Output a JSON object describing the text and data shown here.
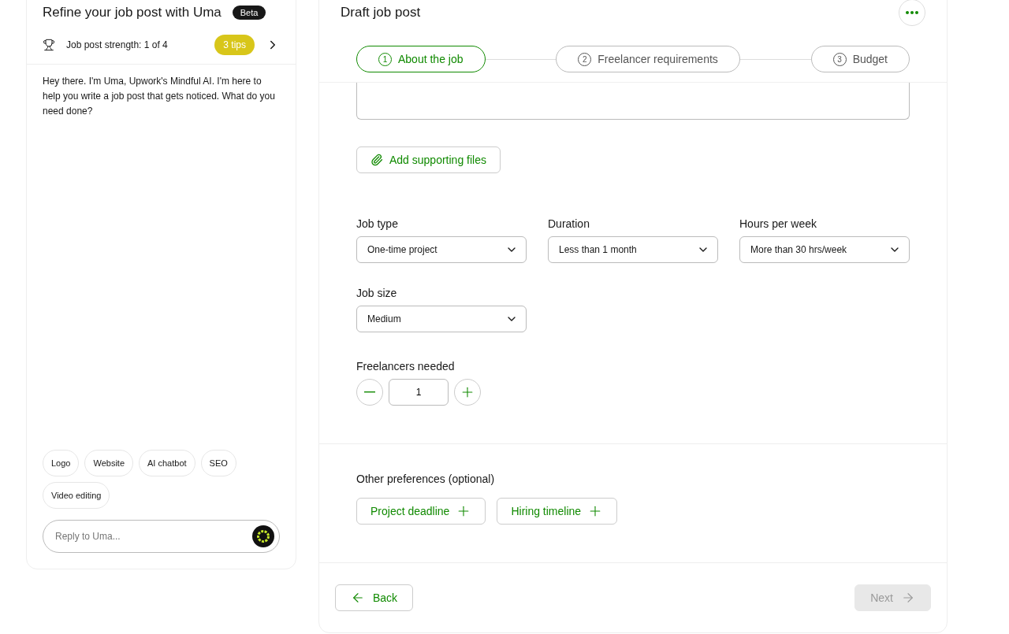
{
  "assistant": {
    "title": "Refine your job post with Uma",
    "badge": "Beta",
    "strength": {
      "label": "Job post strength: 1 of 4",
      "tips": "3 tips"
    },
    "message": "Hey there. I'm Uma, Upwork's Mindful AI. I'm here to help you write a job post that gets noticed. What do you need done?",
    "suggestions": [
      "Logo",
      "Website",
      "AI chatbot",
      "SEO",
      "Video editing"
    ],
    "reply": {
      "placeholder": "Reply to Uma..."
    }
  },
  "editor": {
    "title": "Draft job post",
    "steps": [
      {
        "number": "1",
        "label": "About the job",
        "selected": true
      },
      {
        "number": "2",
        "label": "Freelancer requirements",
        "selected": false
      },
      {
        "number": "3",
        "label": "Budget",
        "selected": false
      }
    ],
    "attach_button": "Add supporting files",
    "selects": [
      {
        "label": "Job type",
        "value": "One-time project"
      },
      {
        "label": "Duration",
        "value": "Less than 1 month"
      },
      {
        "label": "Hours per week",
        "value": "More than 30 hrs/week"
      },
      {
        "label": "Job size",
        "value": "Medium"
      }
    ],
    "freelancers": {
      "label": "Freelancers needed",
      "value": "1"
    },
    "preferences": {
      "label": "Other preferences (optional)",
      "options": [
        "Project deadline",
        "Hiring timeline"
      ]
    },
    "back_button": {
      "label": "Back",
      "disabled": false
    },
    "next_button": {
      "label": "Next",
      "disabled": true
    }
  }
}
